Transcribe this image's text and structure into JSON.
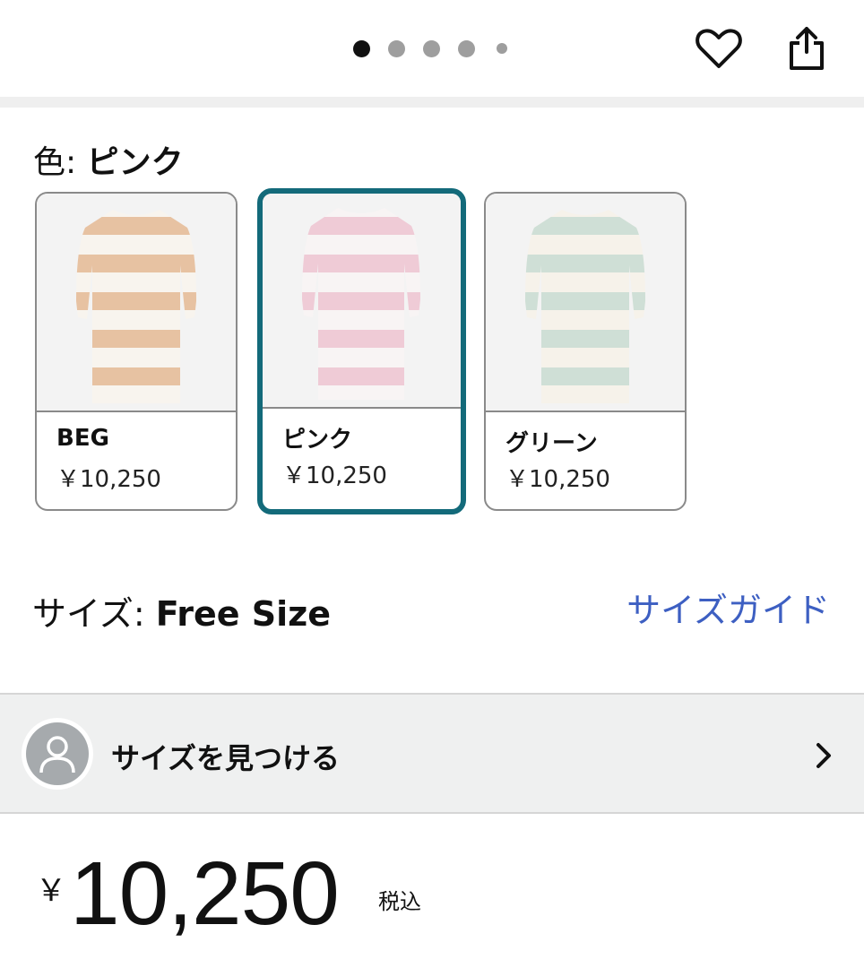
{
  "header": {
    "carousel": {
      "total": 5,
      "active_index": 0
    },
    "favorite_icon": "heart-icon",
    "share_icon": "share-icon"
  },
  "color": {
    "label": "色: ",
    "selected": "ピンク",
    "options": [
      {
        "name": "BEG",
        "price": "￥10,250",
        "stripe_color": "#e7c2a2",
        "selected": false
      },
      {
        "name": "ピンク",
        "price": "￥10,250",
        "stripe_color": "#efcbd6",
        "selected": true
      },
      {
        "name": "グリーン",
        "price": "￥10,250",
        "stripe_color": "#cfdfd6",
        "selected": false
      }
    ]
  },
  "size": {
    "label": "サイズ: ",
    "selected": "Free Size",
    "guide_link": "サイズガイド"
  },
  "find_size": {
    "label": "サイズを見つける",
    "avatar_icon": "user-avatar-icon",
    "chevron_icon": "chevron-right-icon"
  },
  "price": {
    "currency": "￥",
    "amount": "10,250",
    "tax_note": "税込"
  },
  "colors": {
    "selected_border": "#136a7a",
    "link": "#3d5fc2"
  }
}
